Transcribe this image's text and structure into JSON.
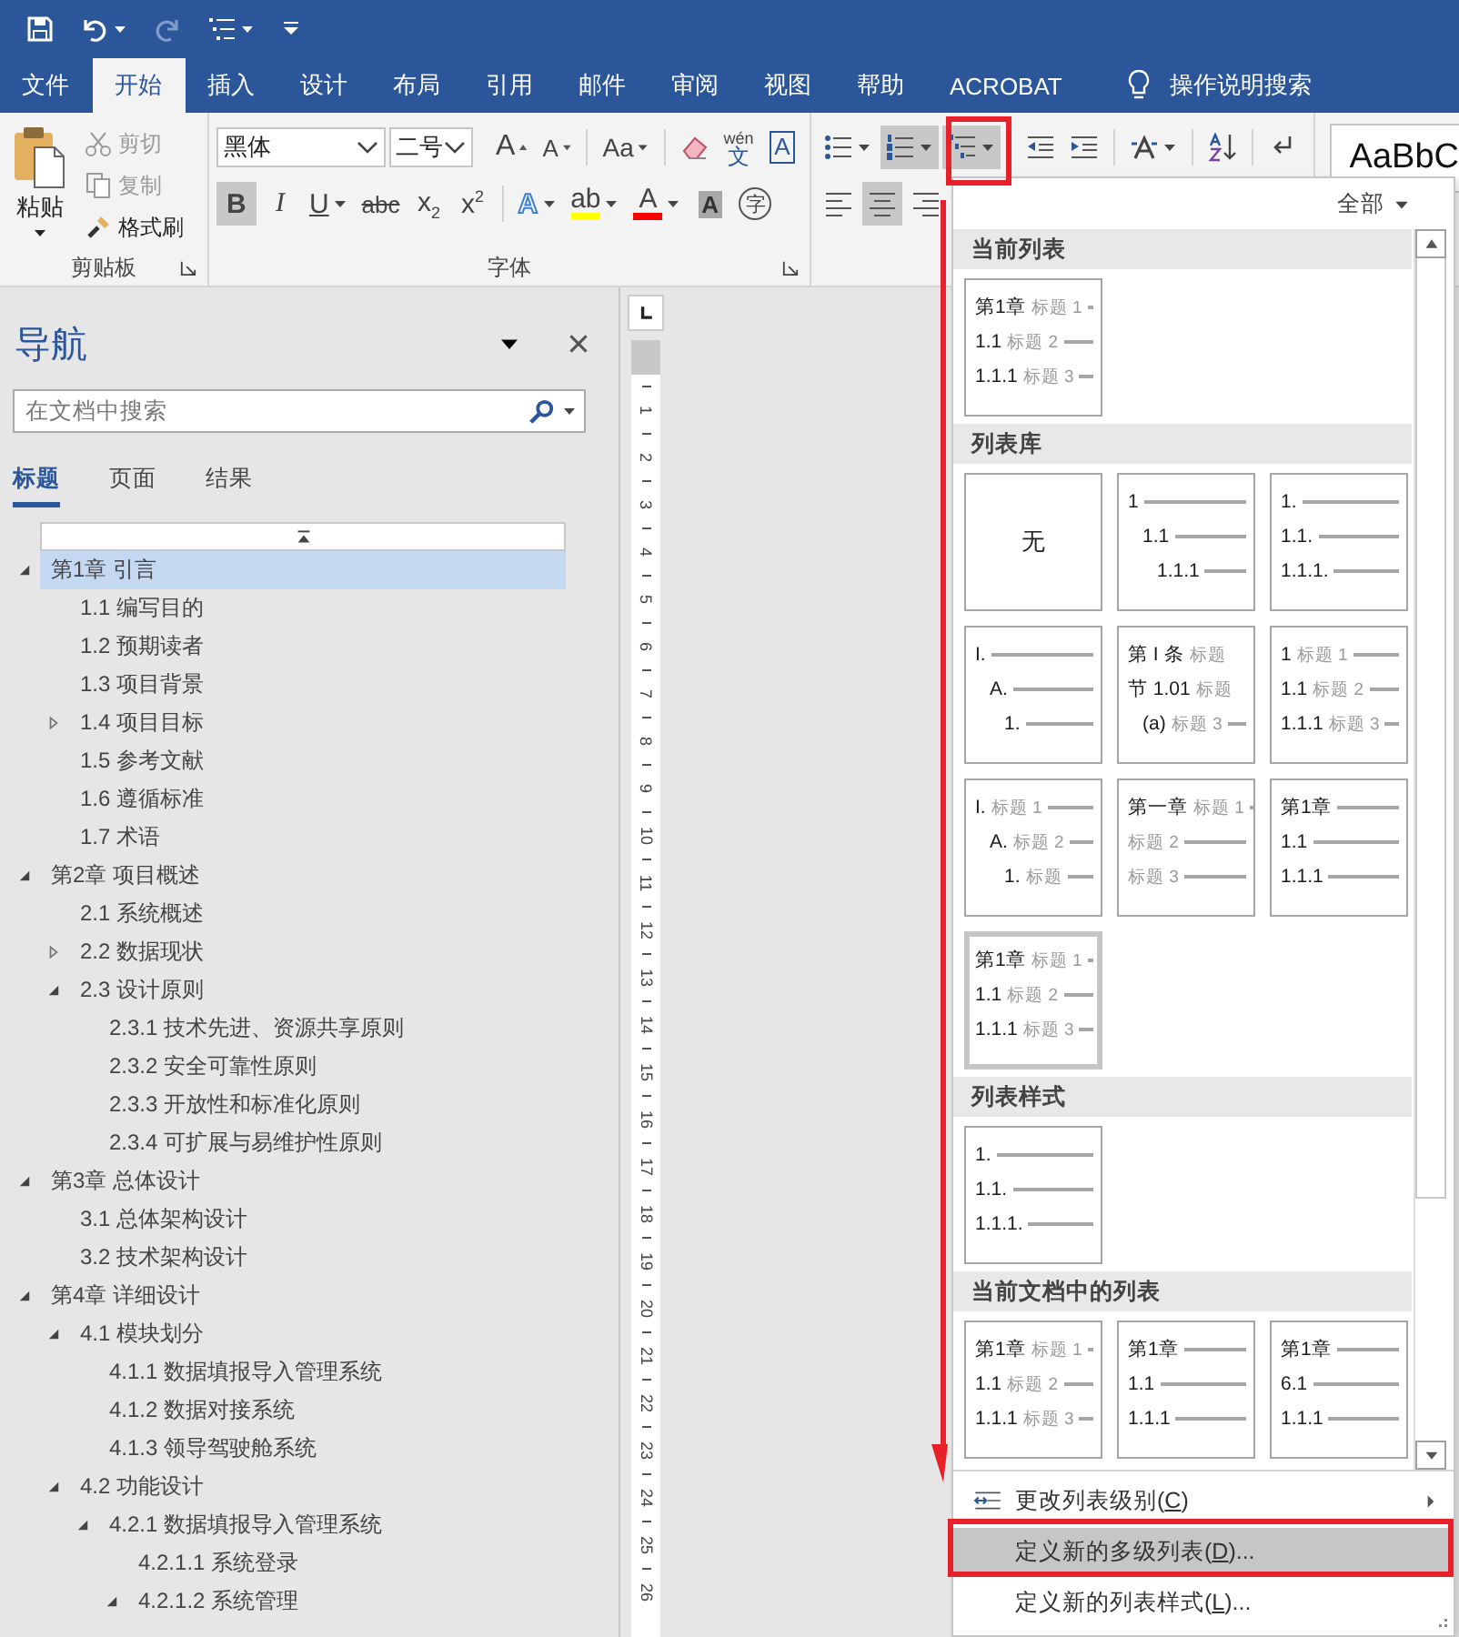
{
  "quick_access": [
    {
      "kind": "save",
      "caret": false,
      "disabled": false
    },
    {
      "kind": "undo",
      "caret": true,
      "disabled": false
    },
    {
      "kind": "redo",
      "caret": false,
      "disabled": true
    },
    {
      "kind": "multilevel",
      "caret": true,
      "disabled": false
    },
    {
      "kind": "customize",
      "caret": false,
      "disabled": false
    }
  ],
  "tabs": [
    {
      "label": "文件",
      "selected": false
    },
    {
      "label": "开始",
      "selected": true
    },
    {
      "label": "插入",
      "selected": false
    },
    {
      "label": "设计",
      "selected": false
    },
    {
      "label": "布局",
      "selected": false
    },
    {
      "label": "引用",
      "selected": false
    },
    {
      "label": "邮件",
      "selected": false
    },
    {
      "label": "审阅",
      "selected": false
    },
    {
      "label": "视图",
      "selected": false
    },
    {
      "label": "帮助",
      "selected": false
    },
    {
      "label": "ACROBAT",
      "selected": false
    }
  ],
  "tell_me": "操作说明搜索",
  "ribbon": {
    "clipboard": {
      "paste": "粘贴",
      "label": "剪贴板",
      "items": [
        {
          "kind": "cut",
          "label": "剪切",
          "disabled": true
        },
        {
          "kind": "copy",
          "label": "复制",
          "disabled": true
        },
        {
          "kind": "painter",
          "label": "格式刷",
          "disabled": false
        }
      ]
    },
    "font": {
      "name": "黑体",
      "size": "二号",
      "label": "字体",
      "row1": [
        [
          {
            "kind": "grow",
            "glyph": "A"
          },
          {
            "kind": "shrink",
            "glyph": "A"
          }
        ],
        [
          {
            "kind": "case",
            "glyph": "Aa",
            "caret": true
          }
        ],
        [
          {
            "kind": "clear"
          },
          {
            "kind": "pinyin",
            "glyph": "文",
            "ruby": "wén"
          },
          {
            "kind": "border",
            "glyph": "A"
          }
        ]
      ],
      "row2": [
        [
          {
            "kind": "bold",
            "glyph": "B",
            "on": true
          },
          {
            "kind": "italic",
            "glyph": "I",
            "on": false
          },
          {
            "kind": "underline",
            "glyph": "U",
            "caret": true,
            "on": false
          },
          {
            "kind": "strike",
            "glyph": "abc",
            "on": false
          },
          {
            "kind": "sub",
            "glyph": "x$_{2}$",
            "on": false
          },
          {
            "kind": "sup",
            "glyph": "x$^{2}$",
            "on": false
          }
        ],
        [
          {
            "kind": "effects",
            "glyph": "A",
            "caret": true,
            "on": false
          },
          {
            "kind": "highlight",
            "glyph": "ab",
            "caret": true,
            "color": "#ffff00",
            "on": false
          },
          {
            "kind": "fontcolor",
            "glyph": "A",
            "caret": true,
            "color": "#ff0000",
            "on": false
          },
          {
            "kind": "shading",
            "glyph": "A",
            "on": false
          },
          {
            "kind": "enclosed",
            "glyph": "字",
            "on": false
          }
        ]
      ]
    },
    "paragraph": {
      "row1": [
        [
          {
            "kind": "bullets",
            "caret": true,
            "on": false
          },
          {
            "kind": "numbering",
            "caret": true,
            "on": true
          },
          {
            "kind": "multilevel",
            "caret": true,
            "on": true
          }
        ],
        [
          {
            "kind": "outdent",
            "on": false
          },
          {
            "kind": "indent",
            "on": false
          }
        ],
        [
          {
            "kind": "layout",
            "caret": true,
            "on": false
          }
        ],
        [
          {
            "kind": "sort",
            "on": false
          }
        ],
        [
          {
            "kind": "marks",
            "on": false
          }
        ]
      ],
      "row2": [
        [
          {
            "kind": "align_left",
            "on": false
          },
          {
            "kind": "align_center",
            "on": true
          },
          {
            "kind": "align_right",
            "on": false
          }
        ]
      ]
    },
    "styles": {
      "preview": "AaBbC"
    }
  },
  "navigation": {
    "title": "导航",
    "search": {
      "placeholder": "在文档中搜索"
    },
    "tabs": [
      {
        "label": "标题",
        "selected": true
      },
      {
        "label": "页面",
        "selected": false
      },
      {
        "label": "结果",
        "selected": false
      }
    ],
    "tree": [
      {
        "text": "第1章 引言",
        "expanded": true,
        "selected": true,
        "children": [
          {
            "text": "1.1 编写目的",
            "selected": false
          },
          {
            "text": "1.2 预期读者",
            "selected": false
          },
          {
            "text": "1.3 项目背景",
            "selected": false
          },
          {
            "text": "1.4 项目目标",
            "expanded": false,
            "selected": false
          },
          {
            "text": "1.5 参考文献",
            "selected": false
          },
          {
            "text": "1.6 遵循标准",
            "selected": false
          },
          {
            "text": "1.7 术语",
            "selected": false
          }
        ]
      },
      {
        "text": "第2章 项目概述",
        "expanded": true,
        "selected": false,
        "children": [
          {
            "text": "2.1 系统概述",
            "selected": false
          },
          {
            "text": "2.2 数据现状",
            "expanded": false,
            "selected": false
          },
          {
            "text": "2.3 设计原则",
            "expanded": true,
            "selected": false,
            "children": [
              {
                "text": "2.3.1 技术先进、资源共享原则",
                "selected": false
              },
              {
                "text": "2.3.2 安全可靠性原则",
                "selected": false
              },
              {
                "text": "2.3.3 开放性和标准化原则",
                "selected": false
              },
              {
                "text": "2.3.4 可扩展与易维护性原则",
                "selected": false
              }
            ]
          }
        ]
      },
      {
        "text": "第3章 总体设计",
        "expanded": true,
        "selected": false,
        "children": [
          {
            "text": "3.1 总体架构设计",
            "selected": false
          },
          {
            "text": "3.2 技术架构设计",
            "selected": false
          }
        ]
      },
      {
        "text": "第4章 详细设计",
        "expanded": true,
        "selected": false,
        "children": [
          {
            "text": "4.1 模块划分",
            "expanded": true,
            "selected": false,
            "children": [
              {
                "text": "4.1.1 数据填报导入管理系统",
                "selected": false
              },
              {
                "text": "4.1.2 数据对接系统",
                "selected": false
              },
              {
                "text": "4.1.3 领导驾驶舱系统",
                "selected": false
              }
            ]
          },
          {
            "text": "4.2 功能设计",
            "expanded": true,
            "selected": false,
            "children": [
              {
                "text": "4.2.1 数据填报导入管理系统",
                "expanded": true,
                "selected": false,
                "children": [
                  {
                    "text": "4.2.1.1 系统登录",
                    "selected": false
                  },
                  {
                    "text": "4.2.1.2 系统管理",
                    "expanded": true,
                    "selected": false
                  }
                ]
              }
            ]
          }
        ]
      }
    ]
  },
  "ruler": {
    "numbers": [
      "1",
      "2",
      "3",
      "4",
      "5",
      "6",
      "7",
      "8",
      "9",
      "10",
      "11",
      "12",
      "13",
      "14",
      "15",
      "16",
      "17",
      "18",
      "19",
      "20",
      "21",
      "22",
      "23",
      "24",
      "25",
      "26"
    ]
  },
  "multilevel_menu": {
    "filter": "全部",
    "sections": [
      {
        "title": "当前列表",
        "tiles": [
          {
            "kind": "flush",
            "selected": false,
            "lines": [
              {
                "num": "第1章",
                "label": "标题 1"
              },
              {
                "num": "1.1",
                "label": "标题 2"
              },
              {
                "num": "1.1.1",
                "label": "标题 3"
              }
            ]
          }
        ]
      },
      {
        "title": "列表库",
        "tiles": [
          {
            "kind": "none",
            "selected": false,
            "text": "无"
          },
          {
            "kind": "indented",
            "selected": false,
            "lines": [
              {
                "num": "1"
              },
              {
                "num": "1.1"
              },
              {
                "num": "1.1.1"
              }
            ]
          },
          {
            "kind": "flush",
            "selected": false,
            "lines": [
              {
                "num": "1."
              },
              {
                "num": "1.1."
              },
              {
                "num": "1.1.1."
              }
            ]
          },
          {
            "kind": "indented",
            "selected": false,
            "lines": [
              {
                "num": "I."
              },
              {
                "num": "A."
              },
              {
                "num": "1."
              }
            ]
          },
          {
            "kind": "article",
            "selected": false,
            "lines": [
              {
                "num": "第 I 条",
                "label": "标题"
              },
              {
                "num": "节 1.01",
                "label": "标题"
              },
              {
                "num": "(a)",
                "label": "标题 3"
              }
            ]
          },
          {
            "kind": "flush",
            "selected": false,
            "lines": [
              {
                "num": "1",
                "label": "标题 1"
              },
              {
                "num": "1.1",
                "label": "标题 2"
              },
              {
                "num": "1.1.1",
                "label": "标题 3"
              }
            ]
          },
          {
            "kind": "indented",
            "selected": false,
            "lines": [
              {
                "num": "I.",
                "label": "标题 1"
              },
              {
                "num": "A.",
                "label": "标题 2"
              },
              {
                "num": "1.",
                "label": "标题"
              }
            ]
          },
          {
            "kind": "flush",
            "selected": false,
            "lines": [
              {
                "num": "第一章",
                "label": "标题 1"
              },
              {
                "label": "标题 2"
              },
              {
                "label": "标题 3"
              }
            ]
          },
          {
            "kind": "flush",
            "selected": false,
            "lines": [
              {
                "num": "第1章"
              },
              {
                "num": "1.1"
              },
              {
                "num": "1.1.1"
              }
            ]
          },
          {
            "kind": "flush",
            "selected": true,
            "lines": [
              {
                "num": "第1章",
                "label": "标题 1"
              },
              {
                "num": "1.1",
                "label": "标题 2"
              },
              {
                "num": "1.1.1",
                "label": "标题 3"
              }
            ]
          }
        ]
      },
      {
        "title": "列表样式",
        "tiles": [
          {
            "kind": "flush",
            "selected": false,
            "lines": [
              {
                "num": "1."
              },
              {
                "num": "1.1."
              },
              {
                "num": "1.1.1."
              }
            ]
          }
        ]
      },
      {
        "title": "当前文档中的列表",
        "tiles": [
          {
            "kind": "flush",
            "selected": false,
            "lines": [
              {
                "num": "第1章",
                "label": "标题 1"
              },
              {
                "num": "1.1",
                "label": "标题 2"
              },
              {
                "num": "1.1.1",
                "label": "标题 3"
              }
            ]
          },
          {
            "kind": "flush",
            "selected": false,
            "lines": [
              {
                "num": "第1章"
              },
              {
                "num": "1.1"
              },
              {
                "num": "1.1.1"
              }
            ]
          },
          {
            "kind": "flush",
            "selected": false,
            "lines": [
              {
                "num": "第1章"
              },
              {
                "num": "6.1"
              },
              {
                "num": "1.1.1"
              }
            ]
          }
        ]
      }
    ],
    "commands": [
      {
        "kind": "level",
        "before": "更改列表级别(",
        "key": "C",
        "after": ")",
        "submenu": true,
        "selected": false
      },
      {
        "kind": "plain",
        "before": "定义新的多级列表(",
        "key": "D",
        "after": ")...",
        "submenu": false,
        "selected": true
      },
      {
        "kind": "plain",
        "before": "定义新的列表样式(",
        "key": "L",
        "after": ")...",
        "submenu": false,
        "selected": false
      }
    ]
  }
}
